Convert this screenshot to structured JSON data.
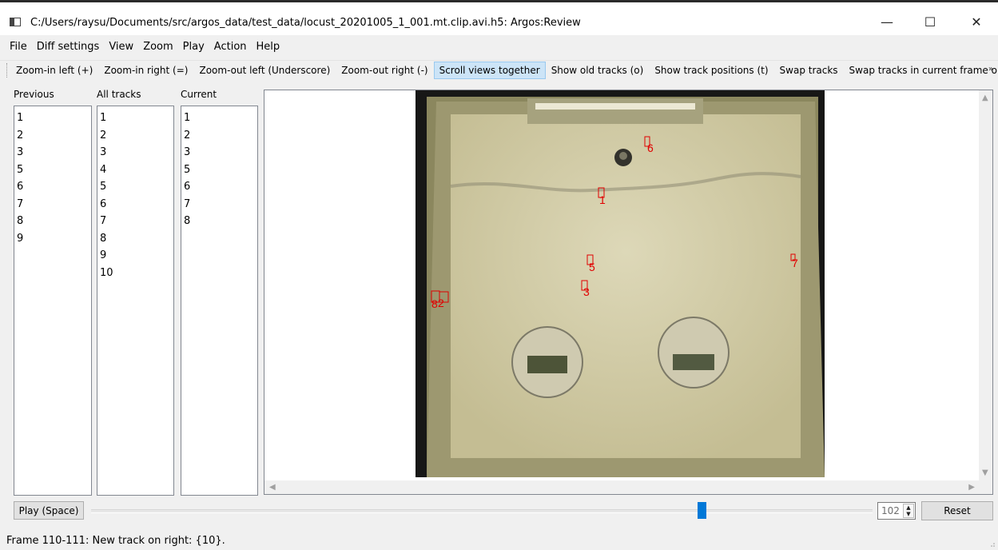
{
  "window": {
    "title": "C:/Users/raysu/Documents/src/argos_data/test_data/locust_20201005_1_001.mt.clip.avi.h5: Argos:Review",
    "minimize": "—",
    "maximize": "☐",
    "close": "✕"
  },
  "menu": [
    "File",
    "Diff settings",
    "View",
    "Zoom",
    "Play",
    "Action",
    "Help"
  ],
  "toolbar": {
    "buttons": [
      "Zoom-in left (+)",
      "Zoom-in right (=)",
      "Zoom-out left (Underscore)",
      "Zoom-out right (-)",
      "Scroll views together",
      "Show old tracks (o)",
      "Show track positions (t)",
      "Swap tracks",
      "Swap tracks in current frame only"
    ],
    "active": "Scroll views together",
    "overflow": "»"
  },
  "lists": {
    "previous": {
      "header": "Previous",
      "items": [
        "1",
        "2",
        "3",
        "5",
        "6",
        "7",
        "8",
        "9"
      ]
    },
    "all_tracks": {
      "header": "All tracks",
      "items": [
        "1",
        "2",
        "3",
        "4",
        "5",
        "6",
        "7",
        "8",
        "9",
        "10"
      ]
    },
    "current": {
      "header": "Current",
      "items": [
        "1",
        "2",
        "3",
        "5",
        "6",
        "7",
        "8"
      ]
    }
  },
  "track_labels": [
    {
      "id": "6"
    },
    {
      "id": "1"
    },
    {
      "id": "5"
    },
    {
      "id": "3"
    },
    {
      "id": "7"
    },
    {
      "id": "8"
    },
    {
      "id": "2"
    }
  ],
  "controls": {
    "play_label": "Play (Space)",
    "frame_value": "102",
    "reset_label": "Reset",
    "slider_fraction": 0.78
  },
  "status": "Frame 110-111: New track on right: {10}.",
  "colors": {
    "track_label": "#e00000",
    "active_button": "#cce4f7",
    "slider_handle": "#0078d7"
  }
}
